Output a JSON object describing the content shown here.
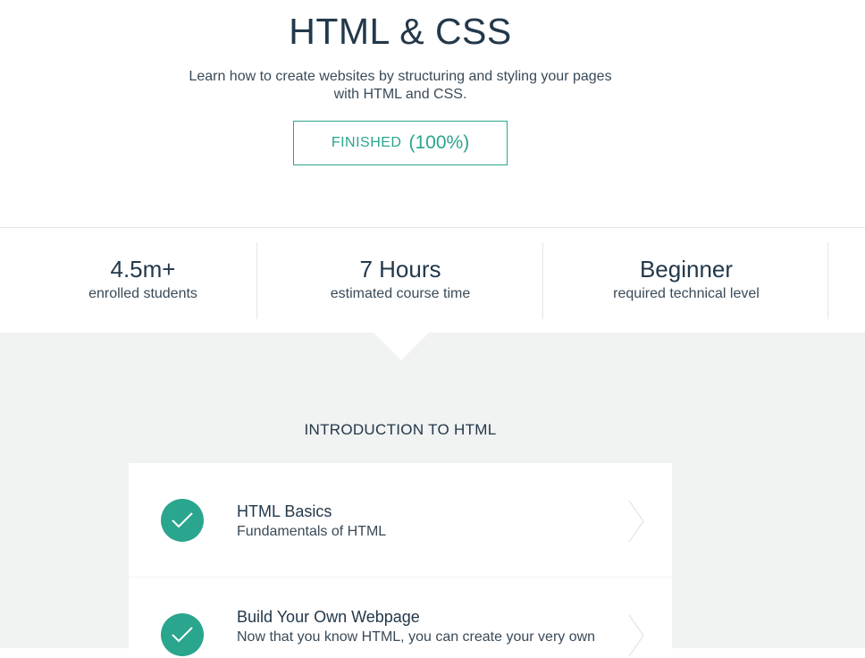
{
  "course": {
    "title": "HTML & CSS",
    "description": "Learn how to create websites by structuring and styling your pages with HTML and CSS.",
    "status_label": "FINISHED",
    "status_percent": "(100%)",
    "progress_fraction": 1.0
  },
  "stats": [
    {
      "value": "4.5m+",
      "caption": "enrolled students"
    },
    {
      "value": "7 Hours",
      "caption": "estimated course time"
    },
    {
      "value": "Beginner",
      "caption": "required technical level"
    }
  ],
  "section": {
    "title": "INTRODUCTION TO HTML",
    "lessons": [
      {
        "title": "HTML Basics",
        "subtitle": "Fundamentals of HTML",
        "completed": true,
        "icon": "check-icon"
      },
      {
        "title": "Build Your Own Webpage",
        "subtitle": "Now that you know HTML, you can create your very own",
        "completed": true,
        "icon": "check-icon"
      }
    ]
  },
  "colors": {
    "accent": "#2aa58e",
    "text_dark": "#23384a",
    "section_bg": "#f1f2f2"
  }
}
